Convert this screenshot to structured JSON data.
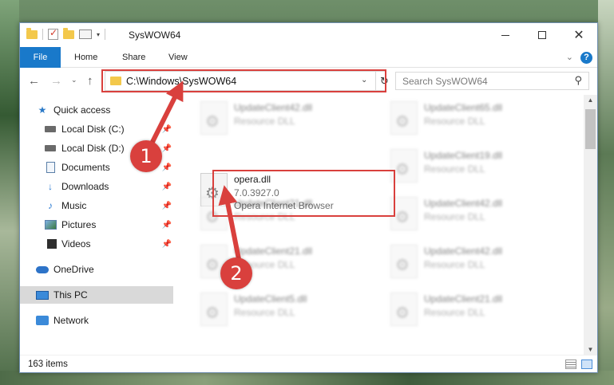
{
  "window": {
    "title": "SysWOW64",
    "controls": {
      "minimize": "",
      "maximize": "",
      "close": "✕"
    }
  },
  "quick_access_toolbar": {
    "dropdown": "▾"
  },
  "ribbon": {
    "tabs": [
      {
        "label": "File"
      },
      {
        "label": "Home"
      },
      {
        "label": "Share"
      },
      {
        "label": "View"
      }
    ],
    "help": "?"
  },
  "address_bar": {
    "path": "C:\\Windows\\SysWOW64",
    "refresh_icon": "↻"
  },
  "search": {
    "placeholder": "Search SysWOW64"
  },
  "nav_pane": {
    "items": [
      {
        "label": "Quick access",
        "icon": "star-icon"
      },
      {
        "label": "Local Disk (C:)",
        "icon": "drive-icon",
        "pinned": true
      },
      {
        "label": "Local Disk (D:)",
        "icon": "drive-icon",
        "pinned": true
      },
      {
        "label": "Documents",
        "icon": "documents-icon",
        "pinned": true
      },
      {
        "label": "Downloads",
        "icon": "download-icon",
        "pinned": true
      },
      {
        "label": "Music",
        "icon": "music-icon",
        "pinned": true
      },
      {
        "label": "Pictures",
        "icon": "pictures-icon",
        "pinned": true
      },
      {
        "label": "Videos",
        "icon": "videos-icon",
        "pinned": true
      },
      {
        "label": "OneDrive",
        "icon": "onedrive-icon"
      },
      {
        "label": "This PC",
        "icon": "this-pc-icon",
        "selected": true
      },
      {
        "label": "Network",
        "icon": "network-icon"
      }
    ]
  },
  "files": [
    {
      "name": "UpdateClient42.dll",
      "line1": "Resource DLL"
    },
    {
      "name": "UpdateClient65.dll",
      "line1": "Resource DLL"
    },
    {
      "name": "opera.dll",
      "line1": "7.0.3927.0",
      "line2": "Opera Internet Browser",
      "highlighted": true
    },
    {
      "name": "UpdateClient19.dll",
      "line1": "Resource DLL"
    },
    {
      "name": "UpdateClient21.dll",
      "line1": "Resource DLL"
    },
    {
      "name": "UpdateClient42.dll",
      "line1": "Resource DLL"
    },
    {
      "name": "UpdateClient21.dll",
      "line1": "Resource DLL"
    },
    {
      "name": "UpdateClient42.dll",
      "line1": "Resource DLL"
    },
    {
      "name": "UpdateClient5.dll",
      "line1": "Resource DLL"
    },
    {
      "name": "UpdateClient21.dll",
      "line1": "Resource DLL"
    }
  ],
  "status": {
    "item_count": "163 items"
  },
  "annotations": [
    {
      "number": "1"
    },
    {
      "number": "2"
    }
  ],
  "colors": {
    "accent": "#1979ca",
    "highlight": "#d9403d",
    "selected_nav": "#d9d9d9"
  }
}
